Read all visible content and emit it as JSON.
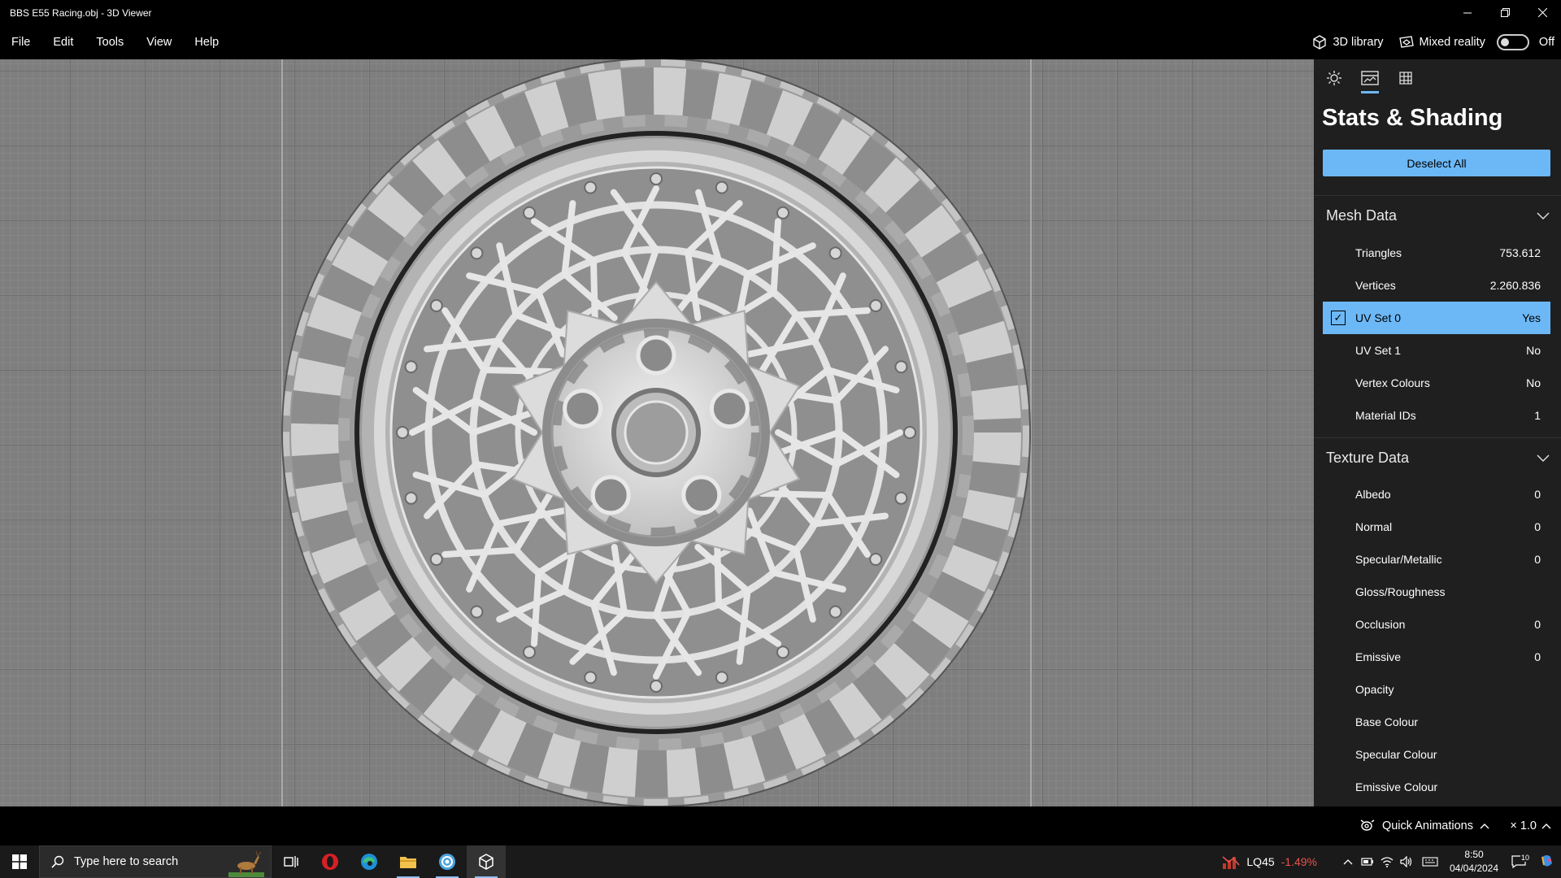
{
  "window": {
    "title": "BBS E55 Racing.obj - 3D Viewer",
    "controls": [
      "minimize",
      "restore",
      "close"
    ]
  },
  "menu": {
    "items": [
      "File",
      "Edit",
      "Tools",
      "View",
      "Help"
    ],
    "library_label": "3D library",
    "mixed_reality_label": "Mixed reality",
    "mixed_reality_state": "Off"
  },
  "panel": {
    "tabs": [
      "lighting-icon",
      "stats-icon",
      "grid-icon"
    ],
    "active_tab": 1,
    "title": "Stats & Shading",
    "deselect_label": "Deselect All",
    "mesh_section": "Mesh Data",
    "mesh_rows": [
      {
        "label": "Triangles",
        "value": "753.612",
        "selected": false
      },
      {
        "label": "Vertices",
        "value": "2.260.836",
        "selected": false
      },
      {
        "label": "UV Set 0",
        "value": "Yes",
        "selected": true
      },
      {
        "label": "UV Set 1",
        "value": "No",
        "selected": false
      },
      {
        "label": "Vertex Colours",
        "value": "No",
        "selected": false
      },
      {
        "label": "Material IDs",
        "value": "1",
        "selected": false
      }
    ],
    "texture_section": "Texture Data",
    "texture_rows": [
      {
        "label": "Albedo",
        "value": "0"
      },
      {
        "label": "Normal",
        "value": "0"
      },
      {
        "label": "Specular/Metallic",
        "value": "0"
      },
      {
        "label": "Gloss/Roughness",
        "value": ""
      },
      {
        "label": "Occlusion",
        "value": "0"
      },
      {
        "label": "Emissive",
        "value": "0"
      },
      {
        "label": "Opacity",
        "value": ""
      },
      {
        "label": "Base Colour",
        "value": ""
      },
      {
        "label": "Specular Colour",
        "value": ""
      },
      {
        "label": "Emissive Colour",
        "value": ""
      }
    ]
  },
  "statusbar": {
    "quick_animations": "Quick Animations",
    "speed": "× 1.0"
  },
  "taskbar": {
    "search_placeholder": "Type here to search",
    "apps": [
      "task-view-icon",
      "opera-icon",
      "edge-icon",
      "file-explorer-icon",
      "browser-icon",
      "3d-viewer-icon"
    ],
    "stock_name": "LQ45",
    "stock_change": "-1.49%",
    "time": "8:50",
    "date": "04/04/2024",
    "notification_count": "10"
  },
  "colors": {
    "accent": "#6cb8f6",
    "panel_bg": "#1f1f1f",
    "viewport_bg": "#7e7e7e",
    "stock_negative": "#e8544e"
  }
}
